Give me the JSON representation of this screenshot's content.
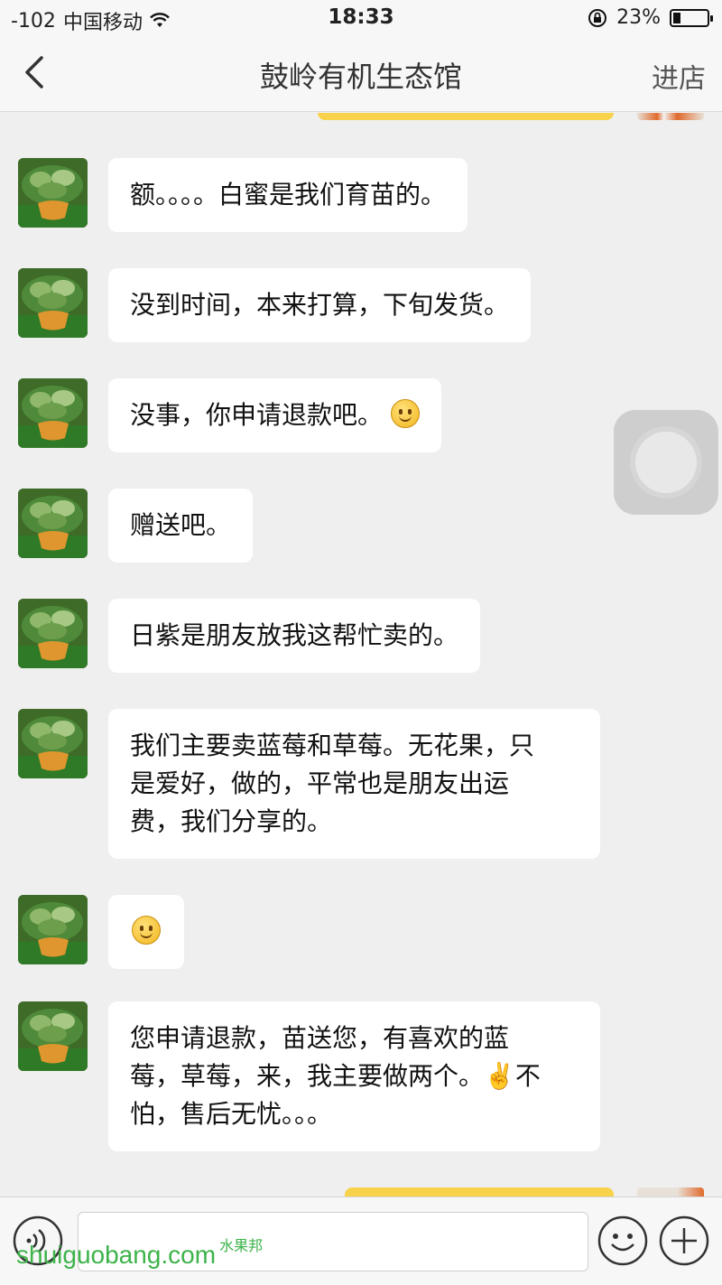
{
  "status_bar": {
    "signal": "-102",
    "carrier": "中国移动",
    "time": "18:33",
    "battery": "23%",
    "battery_level": 0.23
  },
  "nav": {
    "title": "鼓岭有机生态馆",
    "right_link": "进店"
  },
  "messages": [
    {
      "text": "额。。。。白蜜是我们育苗的。"
    },
    {
      "text": "没到时间，本来打算，下旬发货。"
    },
    {
      "text": "没事，你申请退款吧。",
      "emoji": "slightly-smiling-face"
    },
    {
      "text": "赠送吧。"
    },
    {
      "text": "日紫是朋友放我这帮忙卖的。"
    },
    {
      "lines": [
        "我们主要卖蓝莓和草莓。无花果，只",
        "是爱好，做的，平常也是朋友出运",
        "费，我们分享的。"
      ]
    },
    {
      "emoji_only": "slightly-smiling-face"
    },
    {
      "lines": [
        "您申请退款，苗送您，有喜欢的蓝",
        "莓，草莓，来，我主要做两个。",
        "怕，售后无忧。。。"
      ],
      "inline_emoji": "✌️",
      "line2_tail": "不"
    }
  ],
  "input_bar": {
    "placeholder": "",
    "icons": [
      "voice-icon",
      "emoji-icon",
      "plus-icon"
    ]
  },
  "watermark": {
    "text": "shuiguobang",
    "suffix": ".com",
    "small": "水果邦"
  },
  "colors": {
    "accent_yellow": "#f8d24b",
    "watermark_green": "#3db34a",
    "bubble": "#ffffff",
    "background": "#efefef"
  }
}
